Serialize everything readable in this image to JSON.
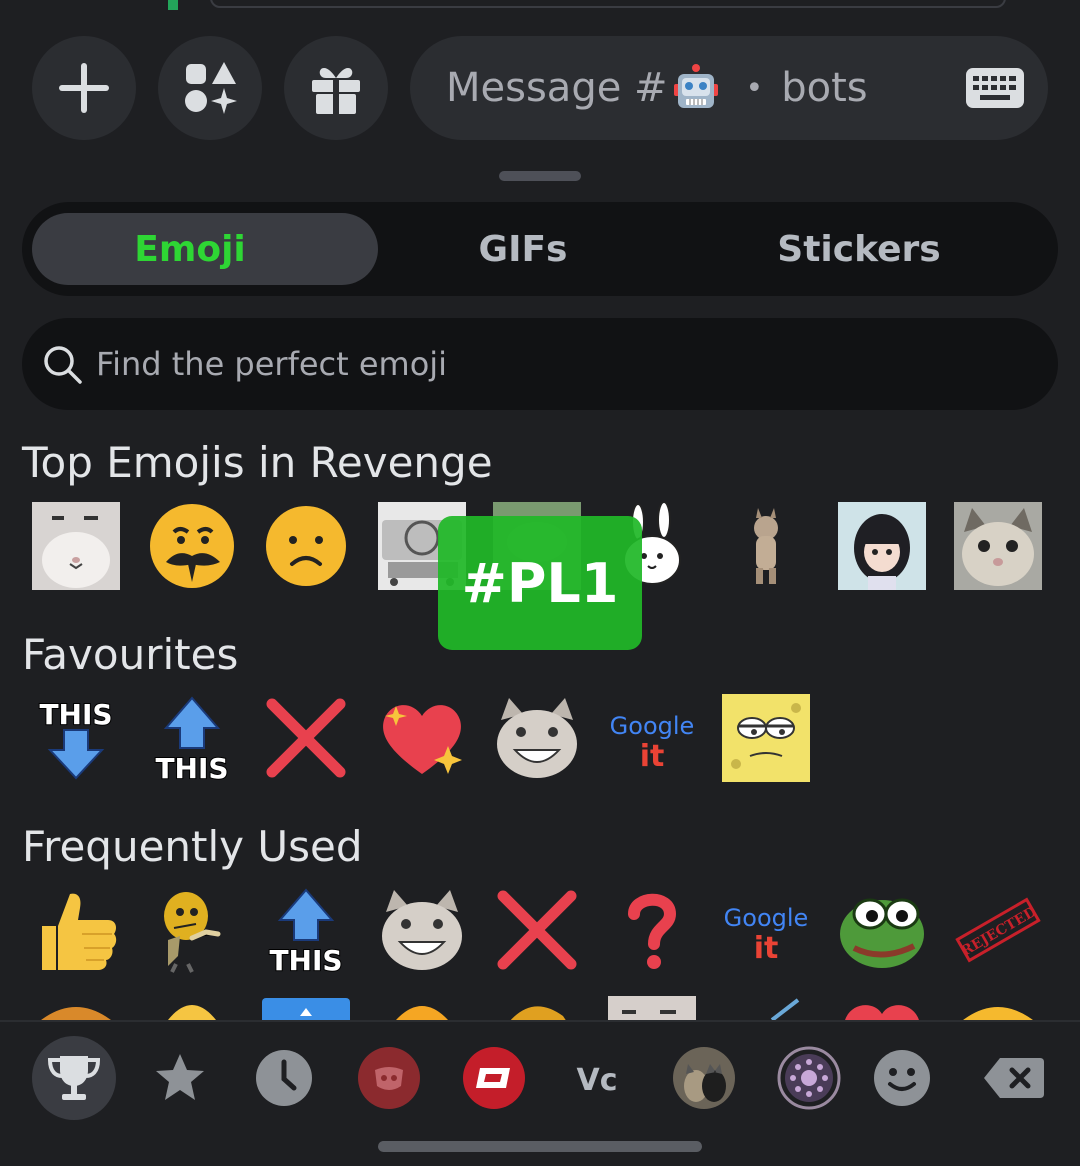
{
  "composer": {
    "message_placeholder_prefix": "Message #",
    "message_placeholder_separator": "•",
    "channel_name": "bots"
  },
  "tabs": [
    {
      "label": "Emoji",
      "active": true
    },
    {
      "label": "GIFs",
      "active": false
    },
    {
      "label": "Stickers",
      "active": false
    }
  ],
  "search": {
    "placeholder": "Find the perfect emoji"
  },
  "sections": {
    "top": "Top Emojis in Revenge",
    "favourites": "Favourites",
    "frequent": "Frequently Used"
  },
  "tooltip": {
    "text": "#PL1"
  },
  "favourites_text": {
    "this1": "THIS",
    "this2": "THIS",
    "google": "Google",
    "google_it": "it"
  },
  "frequent_text": {
    "this": "THIS",
    "google": "Google",
    "google_it": "it",
    "rejected": "REJECTED"
  },
  "categories": [
    {
      "name": "trophy-icon",
      "active": true
    },
    {
      "name": "star-icon"
    },
    {
      "name": "clock-icon"
    },
    {
      "name": "server-mask-icon"
    },
    {
      "name": "server-logo-icon"
    },
    {
      "name": "vc-icon",
      "label": "Vc"
    },
    {
      "name": "cats-avatar-icon"
    },
    {
      "name": "ring-icon"
    },
    {
      "name": "smile-icon"
    },
    {
      "name": "backspace-icon"
    }
  ],
  "colors": {
    "accent": "#2ed634",
    "background": "#1e1f22",
    "surface": "#2b2d31"
  }
}
